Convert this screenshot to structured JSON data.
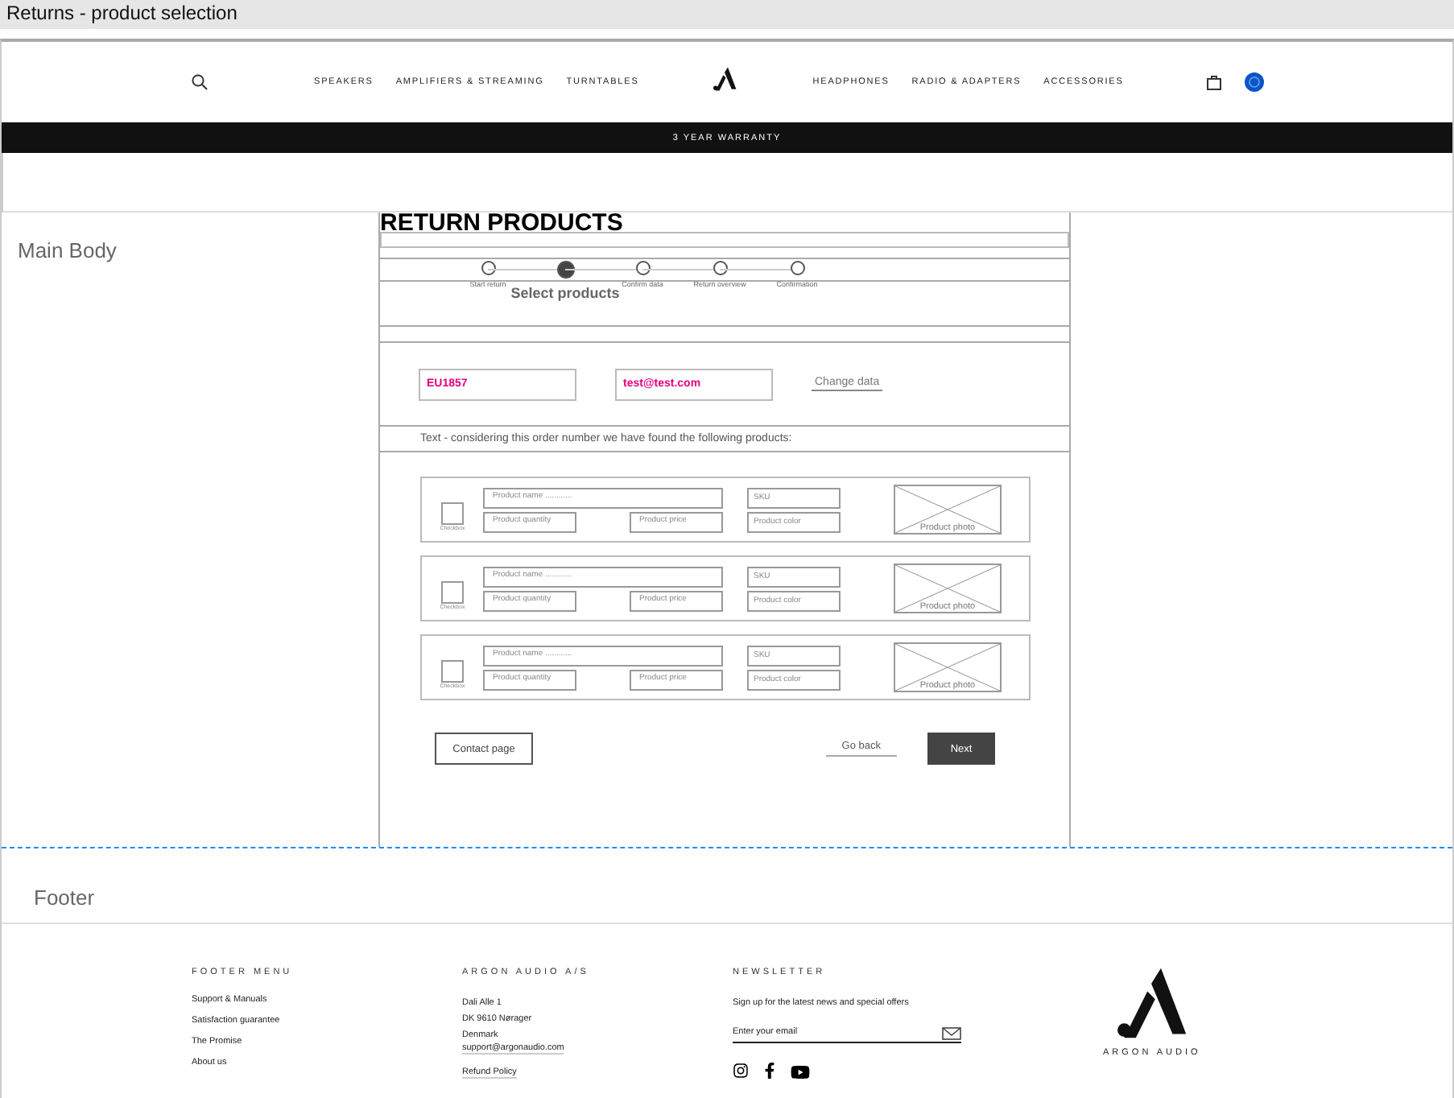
{
  "window": {
    "title": "Returns - product selection"
  },
  "header": {
    "nav_left": [
      "SPEAKERS",
      "AMPLIFIERS & STREAMING",
      "TURNTABLES"
    ],
    "nav_right": [
      "HEADPHONES",
      "RADIO & ADAPTERS",
      "ACCESSORIES"
    ],
    "banner": "3 YEAR WARRANTY"
  },
  "main": {
    "label": "Main Body",
    "title": "RETURN PRODUCTS",
    "steps": [
      {
        "label": "Start return",
        "selected": false
      },
      {
        "label": "Select products",
        "selected": true
      },
      {
        "label": "Confirm data",
        "selected": false
      },
      {
        "label": "Return overview",
        "selected": false
      },
      {
        "label": "Confirmation",
        "selected": false
      }
    ],
    "order_number": "EU1857",
    "email": "test@test.com",
    "change_link": "Change data",
    "intro": "Text - considering this order number we have found the following products:",
    "products": [
      {
        "checkbox_label": "Checkbox",
        "checked": false,
        "name": "Product name ............",
        "quantity": "Product quantity",
        "price": "Product price",
        "sku": "SKU",
        "color_field": "Product color",
        "photo": "Product photo"
      },
      {
        "checkbox_label": "Checkbox",
        "checked": false,
        "name": "Product name ............",
        "quantity": "Product quantity",
        "price": "Product price",
        "sku": "SKU",
        "color_field": "Product color",
        "photo": "Product photo"
      },
      {
        "checkbox_label": "Checkbox",
        "checked": false,
        "name": "Product name ............",
        "quantity": "Product quantity",
        "price": "Product price",
        "sku": "SKU",
        "color_field": "Product color",
        "photo": "Product photo"
      }
    ],
    "buttons": {
      "contact": "Contact page",
      "back": "Go back",
      "next": "Next"
    }
  },
  "footer": {
    "label": "Footer",
    "menu": {
      "heading": "FOOTER MENU",
      "links": [
        "Support & Manuals",
        "Satisfaction guarantee",
        "The Promise",
        "About us"
      ]
    },
    "company": {
      "heading": "ARGON AUDIO A/S",
      "address": [
        "Dali Alle 1",
        "DK 9610 Nørager",
        "Denmark"
      ],
      "email": "support@argonaudio.com",
      "policy": "Refund Policy"
    },
    "newsletter": {
      "heading": "NEWSLETTER",
      "text": "Sign up for the latest news and special offers",
      "placeholder": "Enter your email"
    },
    "brand": "ARGON AUDIO"
  }
}
